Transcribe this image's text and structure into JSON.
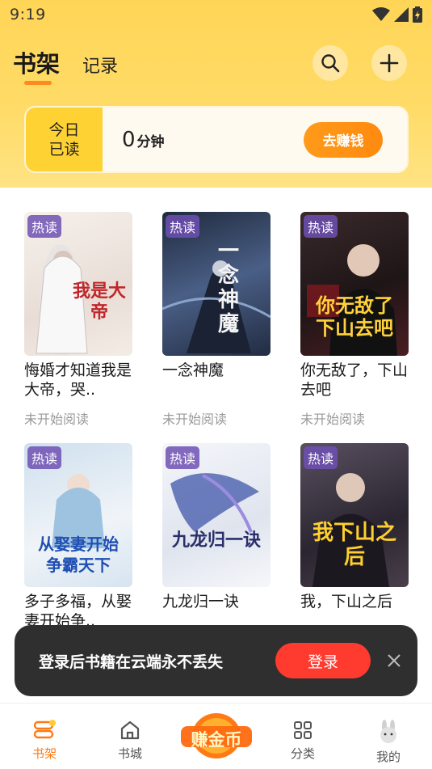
{
  "status_bar": {
    "time": "9:19"
  },
  "header": {
    "tabs": [
      {
        "label": "书架"
      },
      {
        "label": "记录"
      }
    ],
    "search_icon": "search-icon",
    "add_icon": "plus-icon"
  },
  "today": {
    "label_line1": "今日",
    "label_line2": "已读",
    "minutes": "0",
    "unit": "分钟",
    "earn_label": "去赚钱"
  },
  "books": [
    {
      "title": "悔婚才知道我是大帝，哭..",
      "status": "未开始阅读",
      "tag": "热读",
      "cover_text": "我是大帝",
      "cover_bg": "#f2ece6",
      "cover_fg": "#c0262b"
    },
    {
      "title": "一念神魔",
      "status": "未开始阅读",
      "tag": "热读",
      "cover_text": "一念神魔",
      "cover_bg": "#3a4a66",
      "cover_fg": "#f0f0f0"
    },
    {
      "title": "你无敌了，下山去吧",
      "status": "未开始阅读",
      "tag": "热读",
      "cover_text": "你无敌了下山去吧",
      "cover_bg": "#2a1f22",
      "cover_fg": "#ffd23a"
    },
    {
      "title": "多子多福，从娶妻开始争..",
      "status": "",
      "tag": "热读",
      "cover_text": "从娶妻开始争霸天下",
      "cover_bg": "#d9e6f0",
      "cover_fg": "#1f4fb3"
    },
    {
      "title": "九龙归一诀",
      "status": "",
      "tag": "热读",
      "cover_text": "九龙归一诀",
      "cover_bg": "#eef1f6",
      "cover_fg": "#2a2f6b"
    },
    {
      "title": "我，下山之后",
      "status": "",
      "tag": "热读",
      "cover_text": "我下山之后",
      "cover_bg": "#3b3540",
      "cover_fg": "#ffcf2e"
    }
  ],
  "login_banner": {
    "text": "登录后书籍在云端永不丢失",
    "button": "登录"
  },
  "bottom_nav": {
    "items": [
      {
        "label": "书架",
        "icon": "bookshelf-icon",
        "active": true
      },
      {
        "label": "书城",
        "icon": "home-icon"
      },
      {
        "label": "赚金币",
        "icon": "coin-icon"
      },
      {
        "label": "分类",
        "icon": "grid-icon"
      },
      {
        "label": "我的",
        "icon": "rabbit-avatar-icon"
      }
    ]
  },
  "colors": {
    "accent": "#ff8a1f",
    "header_bg": "#ffd557",
    "login_red": "#ff3b30"
  }
}
